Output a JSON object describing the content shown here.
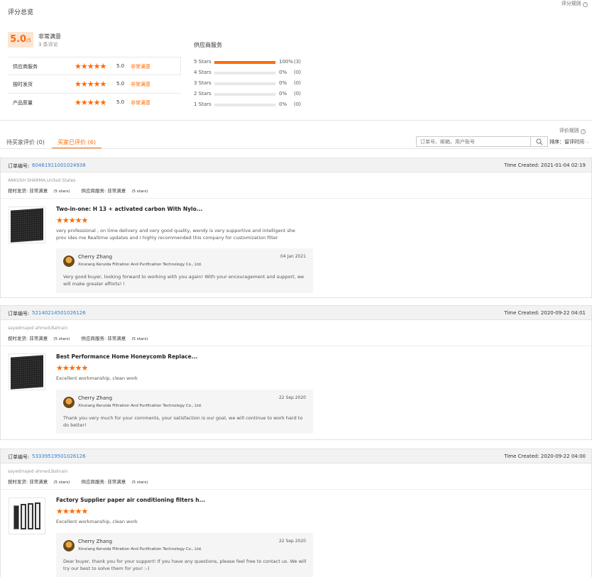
{
  "summary": {
    "title": "评分总览",
    "rule_link": "评分规则",
    "score": "5.0",
    "score_max": "/5",
    "score_desc": "非常满意",
    "review_count": "3 条评论",
    "metrics": [
      {
        "label": "供应商服务",
        "score": "5.0",
        "desc": "非常满意"
      },
      {
        "label": "按时发货",
        "score": "5.0",
        "desc": "非常满意"
      },
      {
        "label": "产品质量",
        "score": "5.0",
        "desc": "非常满意"
      }
    ],
    "distribution_title": "供应商服务",
    "distribution": [
      {
        "label": "5 Stars",
        "percent_text": "100%",
        "count": "(3)",
        "fraction": 1.0
      },
      {
        "label": "4 Stars",
        "percent_text": "0%",
        "count": "(0)",
        "fraction": 0
      },
      {
        "label": "3 Stars",
        "percent_text": "0%",
        "count": "(0)",
        "fraction": 0
      },
      {
        "label": "2 Stars",
        "percent_text": "0%",
        "count": "(0)",
        "fraction": 0
      },
      {
        "label": "1 Stars",
        "percent_text": "0%",
        "count": "(0)",
        "fraction": 0
      }
    ]
  },
  "reviews_toolbar": {
    "rule_link": "评价规则",
    "tab_pending": "待买家评价 (0)",
    "tab_done": "买家已评价 (6)",
    "search_placeholder": "订单号、邮箱、用户账号",
    "sort_label": "排序：",
    "sort_value": "留评时间"
  },
  "orders": [
    {
      "order_label": "订单编号:",
      "order_no": "60461911001024938",
      "time_created": "Time Created: 2021-01-04 02:19",
      "buyer": "ANKUSH SHARMA,United States",
      "ontime_label": "按时发货:",
      "ontime_value": "非常满意",
      "ontime_stars": "(5 stars)",
      "service_label": "供应商服务:",
      "service_value": "非常满意",
      "service_stars": "(5 stars)",
      "product_title": "Two-in-one: H 13 + activated carbon With Nylo...",
      "review_text": "very professional , on time delivery and very good quality,  wendy is very  supportive and intelligent she prov ides me Realtime updates and I highly recommended this company  for customization filter",
      "reply_name": "Cherry Zhang",
      "reply_company": "Xinxiang Keruida Filtration And Purification Technology Co., Ltd.",
      "reply_date": "04 Jan 2021",
      "reply_text": "Very good buyer, looking forward to working with you again! With your encouragement and support, we will make greater efforts! !"
    },
    {
      "order_label": "订单编号:",
      "order_no": "52140214501026126",
      "time_created": "Time Created: 2020-09-22 04:01",
      "buyer": "sayedmajed ahmed,Bahrain",
      "ontime_label": "按时发货:",
      "ontime_value": "非常满意",
      "ontime_stars": "(5 stars)",
      "service_label": "供应商服务:",
      "service_value": "非常满意",
      "service_stars": "(5 stars)",
      "product_title": "Best Performance Home Honeycomb Replace...",
      "review_text": "Excellent workmanship, clean work",
      "reply_name": "Cherry Zhang",
      "reply_company": "Xinxiang Keruida Filtration And Purification Technology Co., Ltd.",
      "reply_date": "22 Sep 2020",
      "reply_text": "Thank you very much for your comments, your satisfaction is our goal, we will continue to work hard to do better!"
    },
    {
      "order_label": "订单编号:",
      "order_no": "53339519501026126",
      "time_created": "Time Created: 2020-09-22 04:00",
      "buyer": "sayedmajed ahmed,Bahrain",
      "ontime_label": "按时发货:",
      "ontime_value": "非常满意",
      "ontime_stars": "(5 stars)",
      "service_label": "供应商服务:",
      "service_value": "非常满意",
      "service_stars": "(5 stars)",
      "product_title": "Factory Supplier paper air conditioning filters h...",
      "review_text": "Excellent workmanship, clean work",
      "reply_name": "Cherry Zhang",
      "reply_company": "Xinxiang Keruida Filtration And Purification Technology Co., Ltd.",
      "reply_date": "22 Sep 2020",
      "reply_text": "Dear buyer, thank you for your support! If you have any questions, please feel free to contact us. We will try our best to solve them for you! :-)"
    }
  ],
  "icons": {
    "star": "star-icon",
    "search": "search-icon",
    "help": "help-circle-icon",
    "chevron": "chevron-down-icon"
  },
  "colors": {
    "accent": "#ff6a00",
    "link": "#2f7fd0"
  }
}
